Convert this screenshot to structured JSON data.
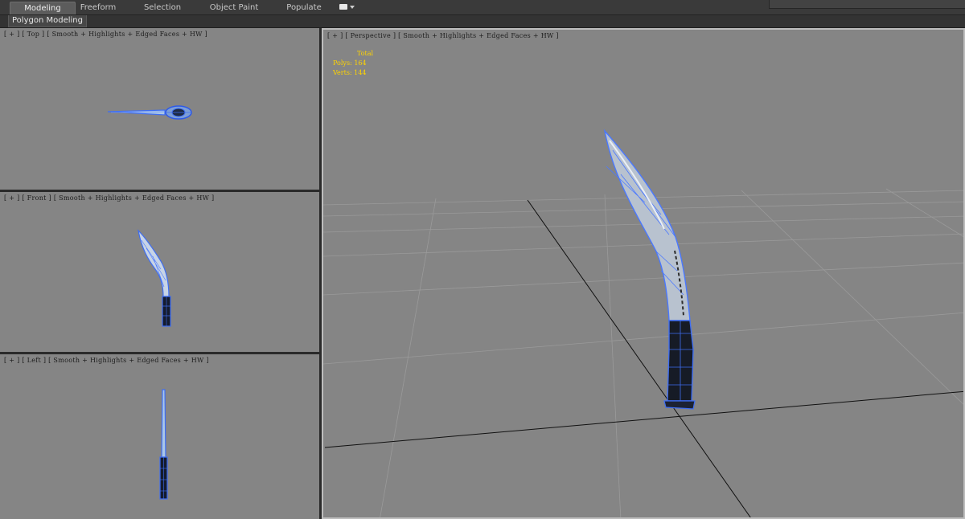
{
  "ribbon": {
    "tabs": [
      "Modeling",
      "Freeform",
      "Selection",
      "Object Paint",
      "Populate"
    ],
    "active_tab": "Modeling",
    "panel_label": "Polygon Modeling"
  },
  "viewports": {
    "top": {
      "plus": "[ + ]",
      "view": "[ Top ]",
      "shading": "[ Smooth + Highlights + Edged Faces + HW ]"
    },
    "front": {
      "plus": "[ + ]",
      "view": "[ Front ]",
      "shading": "[ Smooth + Highlights + Edged Faces + HW ]"
    },
    "left": {
      "plus": "[ + ]",
      "view": "[ Left ]",
      "shading": "[ Smooth + Highlights + Edged Faces + HW ]"
    },
    "perspective": {
      "plus": "[ + ]",
      "view": "[ Perspective ]",
      "shading": "[ Smooth + Highlights + Edged Faces + HW ]"
    }
  },
  "stats": {
    "header": "Total",
    "polys_label": "Polys:",
    "polys_value": "164",
    "verts_label": "Verts:",
    "verts_value": "144"
  },
  "colors": {
    "viewport_bg": "#858585",
    "wire_blue": "#4a78ff",
    "stats_yellow": "#ffd400",
    "active_border": "#bdbdbd"
  }
}
